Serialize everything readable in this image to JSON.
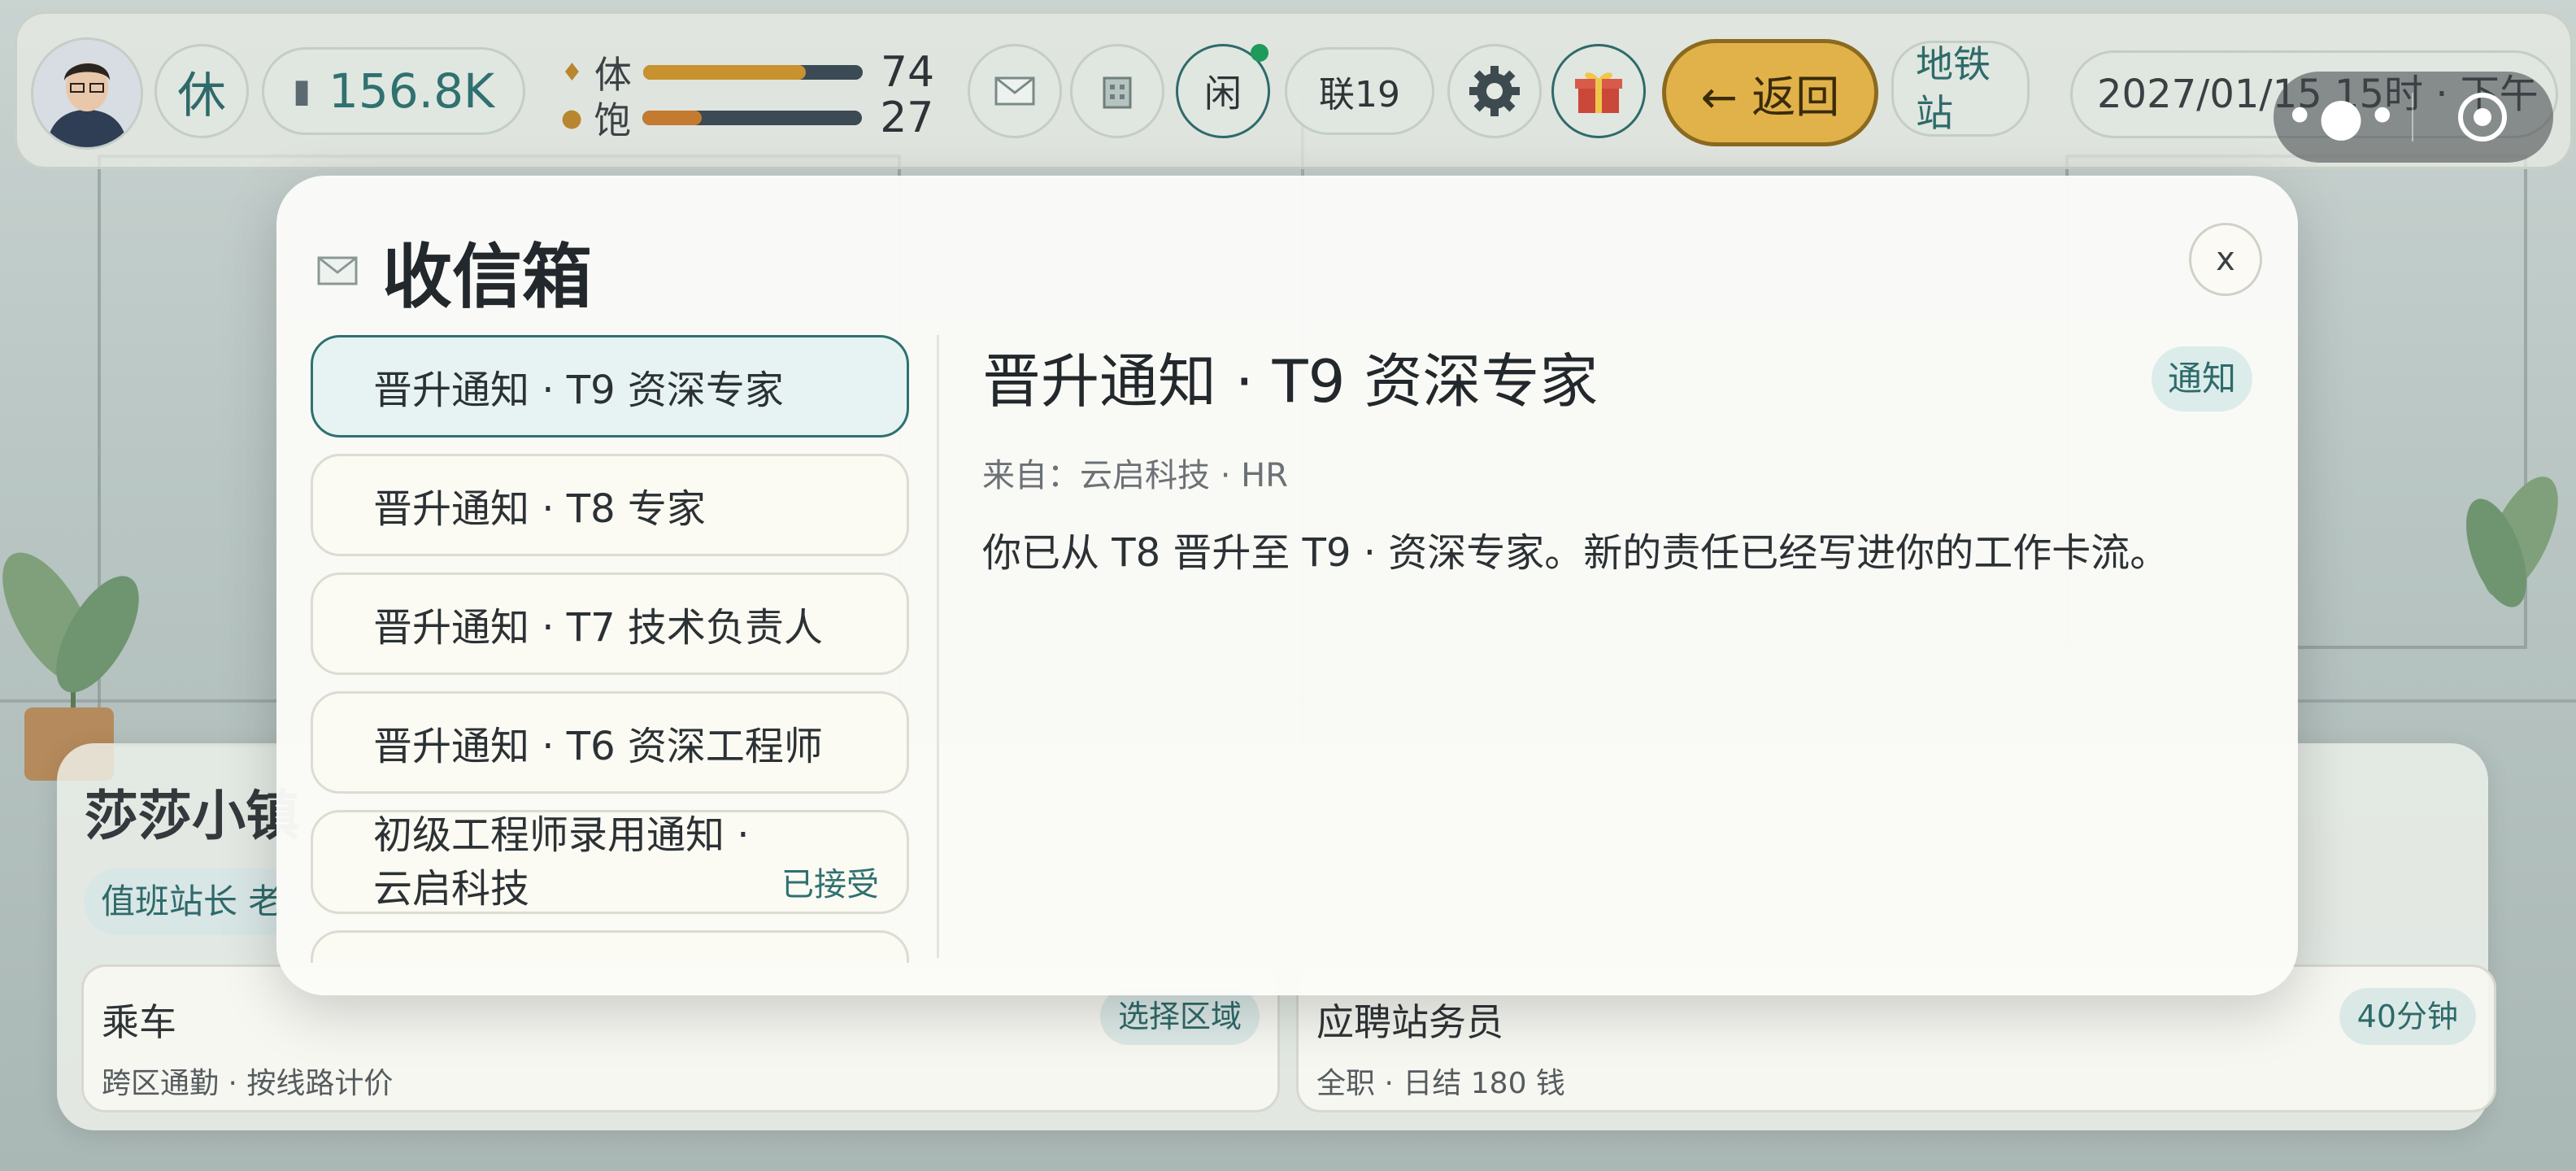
{
  "topbar": {
    "status_label": "休",
    "money": "156.8K",
    "stats": [
      {
        "label": "体",
        "value": "74",
        "fraction": 0.74,
        "color": "#c8922f"
      },
      {
        "label": "饱",
        "value": "27",
        "fraction": 0.27,
        "color": "#c47a30"
      }
    ],
    "idle_label": "闲",
    "contacts_label": "联19",
    "back_label": "← 返回",
    "location_label": "地铁站",
    "datetime": "2027/01/15 15时 · 下午"
  },
  "modal": {
    "title": "收信箱",
    "close_label": "x",
    "messages": [
      {
        "title": "晋升通知 · T9 资深专家",
        "status": ""
      },
      {
        "title": "晋升通知 · T8 专家",
        "status": ""
      },
      {
        "title": "晋升通知 · T7 技术负责人",
        "status": ""
      },
      {
        "title": "晋升通知 · T6 资深工程师",
        "status": ""
      },
      {
        "title": "初级工程师录用通知 · 云启科技",
        "status": "已接受"
      }
    ],
    "detail": {
      "title": "晋升通知 · T9 资深专家",
      "tag": "通知",
      "from": "来自：云启科技 · HR",
      "body": "你已从 T8 晋升至 T9 · 资深专家。新的责任已经写进你的工作卡流。"
    }
  },
  "background": {
    "station_name": "莎莎小镇",
    "chip": "值班站长 老",
    "cards": [
      {
        "title": "乘车",
        "subtitle": "跨区通勤 · 按线路计价",
        "tag": "选择区域"
      },
      {
        "title": "应聘站务员",
        "subtitle": "全职 · 日结 180 钱",
        "tag": "40分钟"
      }
    ]
  },
  "colors": {
    "accent": "#2f7170",
    "back_button": "#e2b24a",
    "online_dot": "#1e9a5a"
  }
}
